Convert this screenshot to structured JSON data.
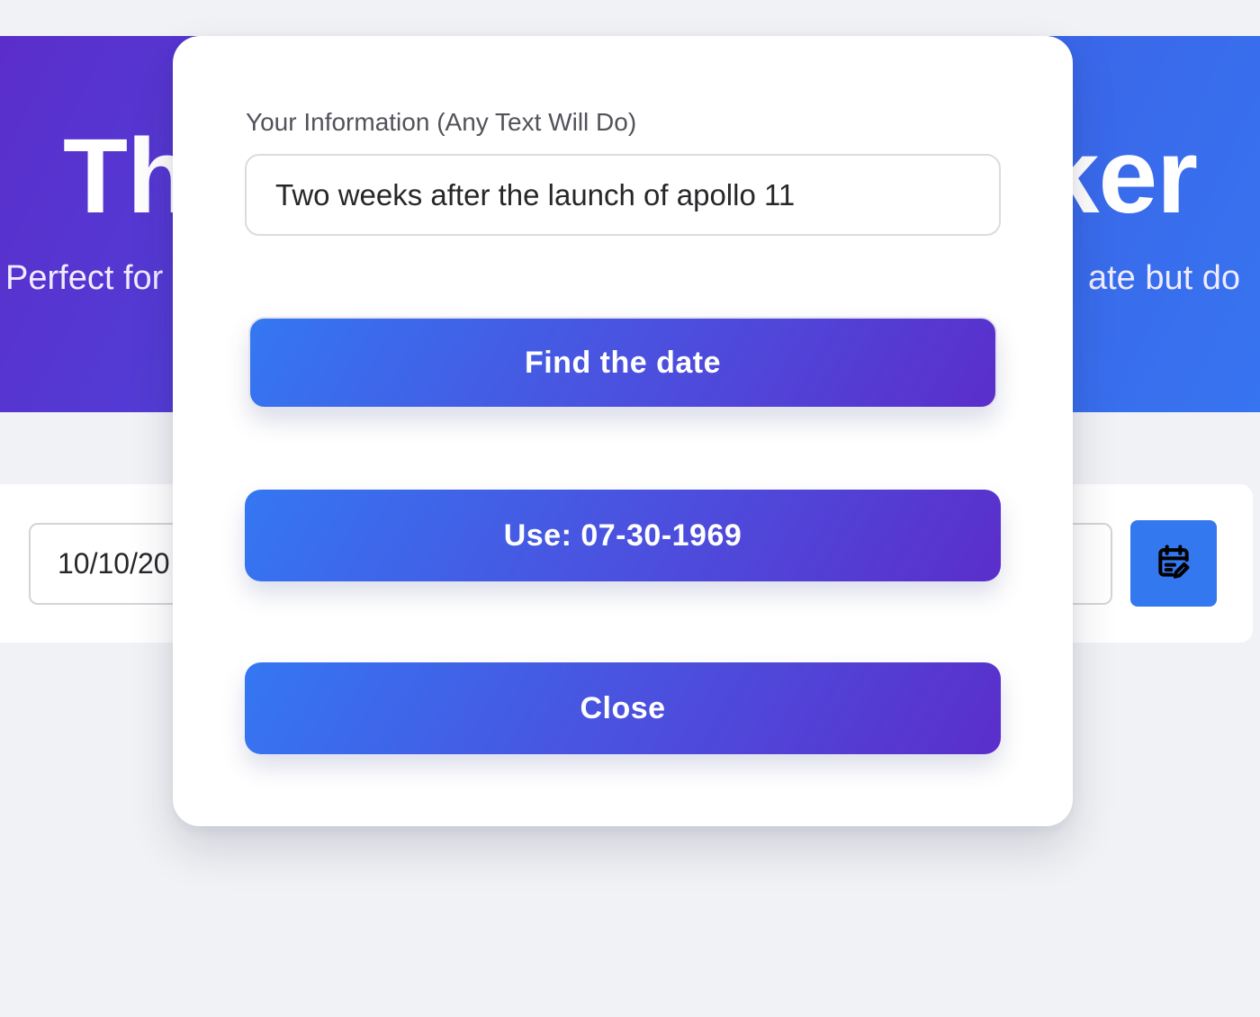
{
  "hero": {
    "title_left": "Th",
    "title_right": "ker",
    "subtitle_left": "Perfect for",
    "subtitle_right": "ate but do"
  },
  "date_field": {
    "value": "10/10/20"
  },
  "calendar_button": {
    "icon": "calendar-edit-icon",
    "color": "#3478f0"
  },
  "modal": {
    "field_label": "Your Information (Any Text Will Do)",
    "field_value": "Two weeks after the launch of apollo 11",
    "find_button_label": "Find the date",
    "use_button_label": "Use: 07-30-1969",
    "close_button_label": "Close"
  },
  "colors": {
    "gradient_start": "#3477f2",
    "gradient_end": "#5b2ecb",
    "page_background": "#f0f2f5"
  }
}
